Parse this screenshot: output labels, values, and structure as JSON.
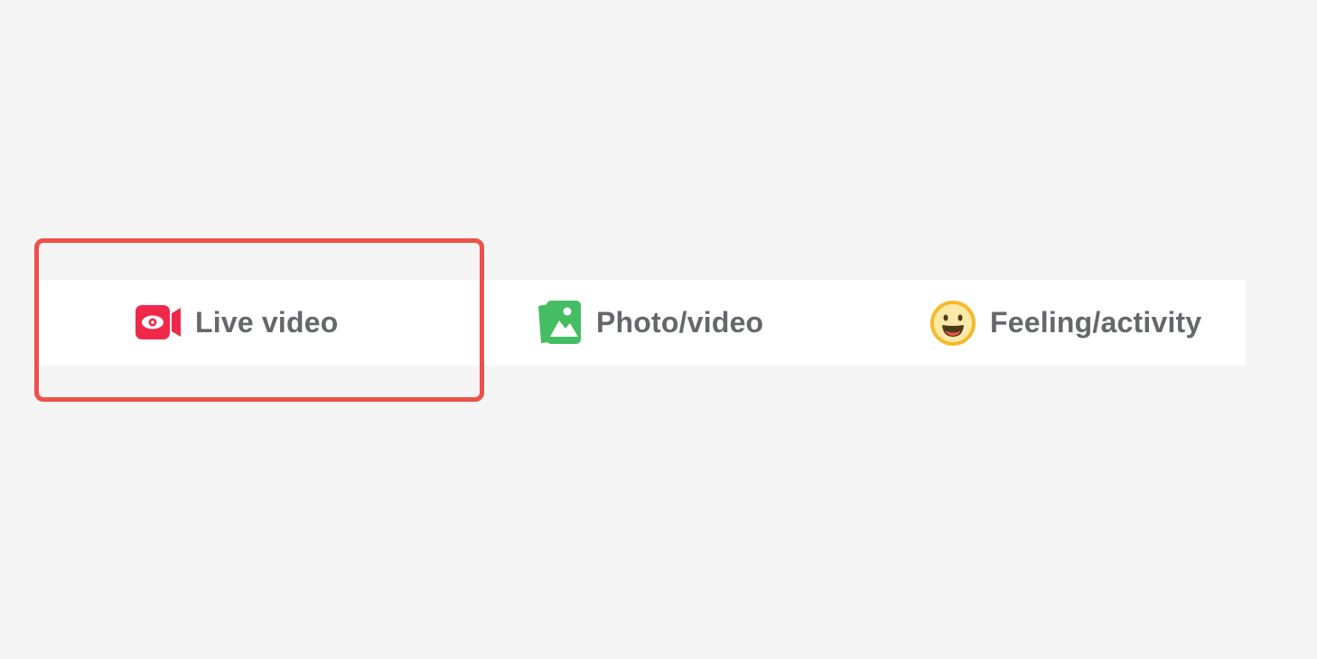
{
  "composer_actions": {
    "items": [
      {
        "id": "live",
        "label": "Live video",
        "icon": "live-video-icon",
        "color": "#f02849"
      },
      {
        "id": "photo",
        "label": "Photo/video",
        "icon": "photo-video-icon",
        "color": "#45bd62"
      },
      {
        "id": "feeling",
        "label": "Feeling/activity",
        "icon": "feeling-activity-icon",
        "color": "#f7b928"
      }
    ]
  },
  "highlight": {
    "color": "#f0504a",
    "target": "live"
  },
  "theme": {
    "background": "#f5f5f5",
    "bar_background": "#ffffff",
    "label_color": "#65676b"
  }
}
